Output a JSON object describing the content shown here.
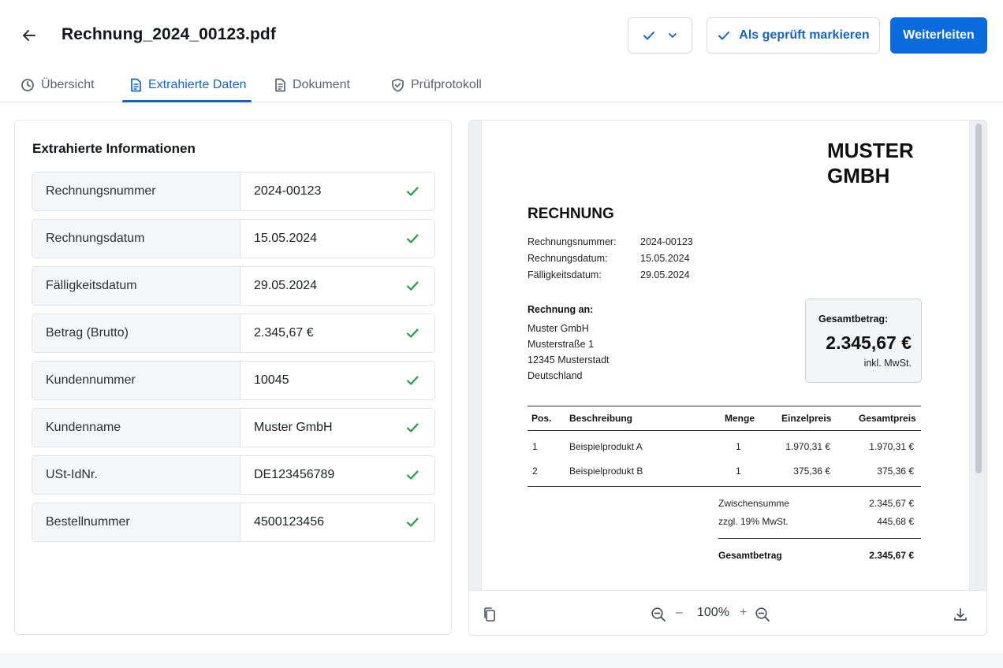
{
  "header": {
    "file_name": "Rechnung_2024_00123.pdf",
    "mark_checked_label": "Als geprüft markieren",
    "forward_label": "Weiterleiten"
  },
  "tabs": [
    {
      "label": "Übersicht",
      "icon": "clock-icon",
      "active": false
    },
    {
      "label": "Extrahierte Daten",
      "icon": "document-icon",
      "active": true
    },
    {
      "label": "Dokument",
      "icon": "document-icon",
      "active": false
    },
    {
      "label": "Prüfprotokoll",
      "icon": "shield-check-icon",
      "active": false
    }
  ],
  "extracted": {
    "title": "Extrahierte Informationen",
    "fields": [
      {
        "label": "Rechnungsnummer",
        "value": "2024-00123",
        "verified": true
      },
      {
        "label": "Rechnungsdatum",
        "value": "15.05.2024",
        "verified": true
      },
      {
        "label": "Fälligkeitsdatum",
        "value": "29.05.2024",
        "verified": true
      },
      {
        "label": "Betrag (Brutto)",
        "value": "2.345,67 €",
        "verified": true
      },
      {
        "label": "Kundennummer",
        "value": "10045",
        "verified": true
      },
      {
        "label": "Kundenname",
        "value": "Muster GmbH",
        "verified": true
      },
      {
        "label": "USt-IdNr.",
        "value": "DE123456789",
        "verified": true
      },
      {
        "label": "Bestellnummer",
        "value": "4500123456",
        "verified": true
      }
    ]
  },
  "document": {
    "company_line1": "MUSTER",
    "company_line2": "GMBH",
    "heading": "RECHNUNG",
    "meta": [
      {
        "label": "Rechnungsnummer:",
        "value": "2024-00123"
      },
      {
        "label": "Rechnungsdatum:",
        "value": "15.05.2024"
      },
      {
        "label": "Fälligkeitsdatum:",
        "value": "29.05.2024"
      }
    ],
    "bill_to_heading": "Rechnung an:",
    "address": [
      "Muster GmbH",
      "Musterstraße 1",
      "12345 Musterstadt",
      "Deutschland"
    ],
    "total_box": {
      "label": "Gesamtbetrag:",
      "amount": "2.345,67 €",
      "note": "inkl. MwSt."
    },
    "table_headers": {
      "pos": "Pos.",
      "desc": "Beschreibung",
      "qty": "Menge",
      "unit": "Einzelpreis",
      "total": "Gesamtpreis"
    },
    "items": [
      {
        "pos": "1",
        "desc": "Beispielprodukt A",
        "qty": "1",
        "unit": "1.970,31 €",
        "total": "1.970,31 €"
      },
      {
        "pos": "2",
        "desc": "Beispielprodukt B",
        "qty": "1",
        "unit": "375,36 €",
        "total": "375,36 €"
      }
    ],
    "subtotal_label": "Zwischensumme",
    "subtotal_value": "2.345,67 €",
    "vat_label": "zzgl. 19% MwSt.",
    "vat_value": "445,68 €",
    "grand_label": "Gesamtbetrag",
    "grand_value": "2.345,67 €"
  },
  "viewer": {
    "zoom": "100%",
    "zoom_out_symbol": "–",
    "zoom_in_symbol": "+"
  },
  "colors": {
    "accent": "#1565c0",
    "primary_button": "#0b6bdc",
    "check_green": "#1e9e4a"
  }
}
